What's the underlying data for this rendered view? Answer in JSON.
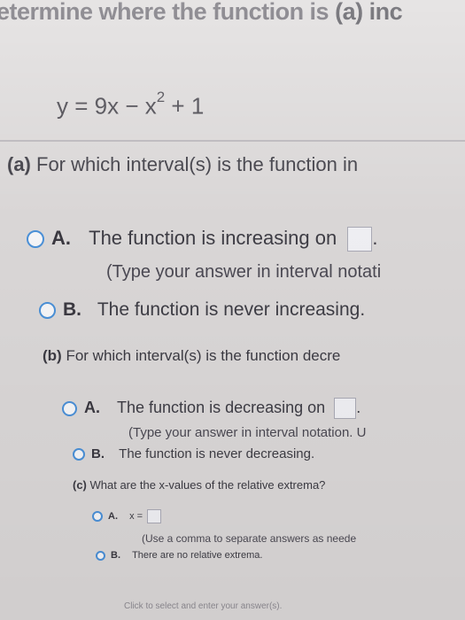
{
  "instruction": {
    "text": "etermine where the function is ",
    "part_a": "(a) inc"
  },
  "equation": {
    "lhs": "y = 9x − x",
    "exponent": "2",
    "rhs": " + 1"
  },
  "part_a": {
    "label": "(a)",
    "question": " For which interval(s) is the function in",
    "option_a": {
      "letter": "A.",
      "text": "The function is increasing on",
      "hint": "(Type your answer in interval notati"
    },
    "option_b": {
      "letter": "B.",
      "text": "The function is never increasing."
    }
  },
  "part_b": {
    "label": "(b)",
    "question": " For which interval(s) is the function decre",
    "option_a": {
      "letter": "A.",
      "text": "The function is decreasing on",
      "hint": "(Type your answer in interval notation. U"
    },
    "option_b": {
      "letter": "B.",
      "text": "The function is never decreasing."
    }
  },
  "part_c": {
    "label": "(c)",
    "question": " What are the x-values of the relative extrema?",
    "option_a": {
      "letter": "A.",
      "text": "x =",
      "hint": "(Use a comma to separate answers as neede"
    },
    "option_b": {
      "letter": "B.",
      "text": "There are no relative extrema."
    }
  },
  "footer": {
    "text": "Click to select and enter your answer(s)."
  },
  "colors": {
    "radio_border": "#4a8fd6",
    "background": "#d9d6d6"
  }
}
